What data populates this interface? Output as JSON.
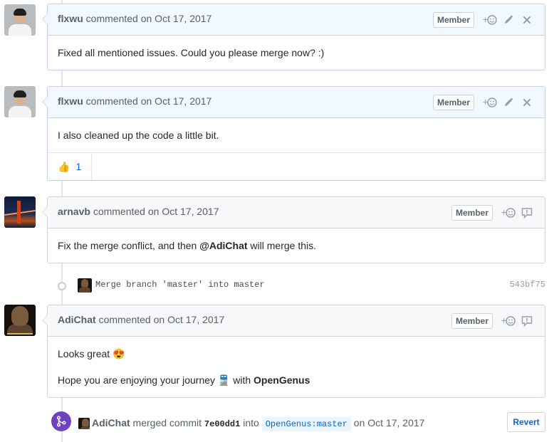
{
  "comments": [
    {
      "author": "flxwu",
      "verb": "commented",
      "date": "on Oct 17, 2017",
      "badge": "Member",
      "body": [
        "Fixed all mentioned issues. Could you please merge now? :)"
      ]
    },
    {
      "author": "flxwu",
      "verb": "commented",
      "date": "on Oct 17, 2017",
      "badge": "Member",
      "body": [
        "I also cleaned up the code a little bit."
      ],
      "reaction": {
        "emoji": "👍",
        "count": "1"
      }
    },
    {
      "author": "arnavb",
      "verb": "commented",
      "date": "on Oct 17, 2017",
      "badge": "Member",
      "body_before": "Fix the merge conflict, and then ",
      "mention": "@AdiChat",
      "body_after": " will merge this."
    },
    {
      "author": "AdiChat",
      "verb": "commented",
      "date": "on Oct 17, 2017",
      "badge": "Member",
      "line1": "Looks great ",
      "line1_emoji": "😍",
      "line2_before": "Hope you are enjoying your journey ",
      "line2_emoji": "🚆",
      "line2_middle": " with ",
      "line2_bold": "OpenGenus"
    }
  ],
  "commit": {
    "message": "Merge branch 'master' into master",
    "sha": "543bf75"
  },
  "merge_event": {
    "author": "AdiChat",
    "text1": " merged commit ",
    "sha": "7e00dd1",
    "text2": " into ",
    "branch": "OpenGenus:master",
    "text3": " on Oct 17, 2017",
    "revert_label": "Revert"
  },
  "icons": {
    "add_reaction": "smiley-plus-icon",
    "edit": "pencil-icon",
    "delete": "x-icon",
    "reply": "comment-reply-icon",
    "merge": "git-merge-icon"
  },
  "colors": {
    "member_header": "#f1f8ff",
    "member_border": "#c0d3eb",
    "gray_header": "#f6f8fa",
    "merge_purple": "#6f42c1",
    "link_blue": "#0366d6"
  }
}
